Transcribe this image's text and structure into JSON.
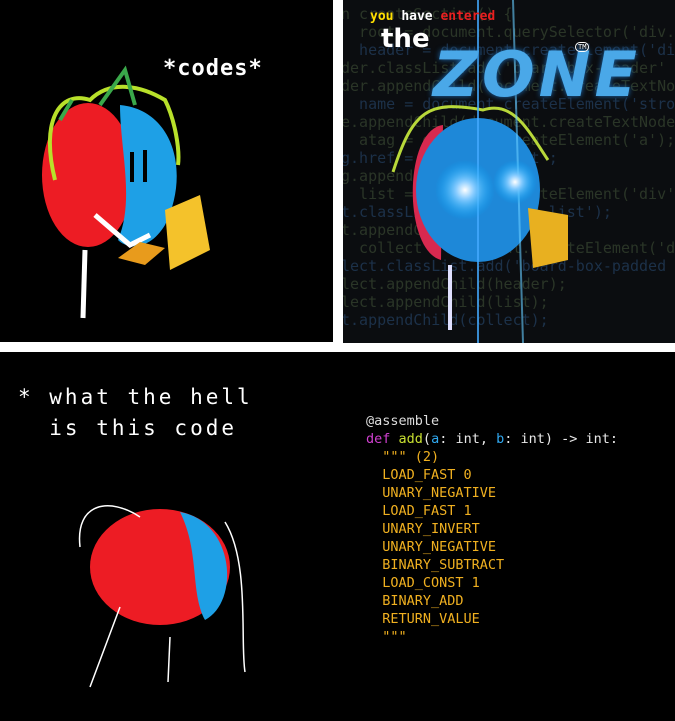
{
  "panel1": {
    "caption": "*codes*"
  },
  "panel2": {
    "title_you": "you",
    "title_have": "have",
    "title_entered": "entered",
    "title_the": "the",
    "title_zone": "ZONE",
    "title_tm": "TM",
    "background_code": [
      "n createSection() {",
      "  root = document.querySelector('div.cell",
      "  header = document.createElement('div');",
      "der.classList.add('board-box-header'",
      "der.appendChild(document.createTextNode(",
      "  name = document.createElement('strong')",
      "e.appendChild(document.createTextNode('O",
      "  atag = document.createElement('a');",
      "g.href = '#pullrequest';",
      "g.appendChild(name);",
      "  list = document.createElement('div');",
      "t.classList.add('board-list');",
      "t.appendChild(atag);",
      "  collect = document.createElement('div')",
      "lect.classList.add('board-box-padded",
      "lect.appendChild(header);",
      "lect.appendChild(list);",
      "t.appendChild(collect);"
    ]
  },
  "panel3": {
    "caption_line1": "* what the hell",
    "caption_line2": "  is this code",
    "code": {
      "decorator": "@assemble",
      "def_kw": "def",
      "func_name": "add",
      "param_a": "a",
      "param_b": "b",
      "sig_part1": "(",
      "sig_part2": ": int, ",
      "sig_part3": ": int) -> int:",
      "docstring_open": "  \"\"\" (2)",
      "ops": [
        "  LOAD_FAST 0",
        "  UNARY_NEGATIVE",
        "  LOAD_FAST 1",
        "  UNARY_INVERT",
        "  UNARY_NEGATIVE",
        "  BINARY_SUBTRACT",
        "  LOAD_CONST 1",
        "  BINARY_ADD",
        "  RETURN_VALUE"
      ],
      "docstring_close": "  \"\"\""
    }
  },
  "colors": {
    "red": "#ed1c24",
    "blue": "#1ea0e6",
    "keyword": "#d040d0",
    "func": "#c8e030",
    "param": "#30a8f0",
    "op": "#f0b020"
  }
}
